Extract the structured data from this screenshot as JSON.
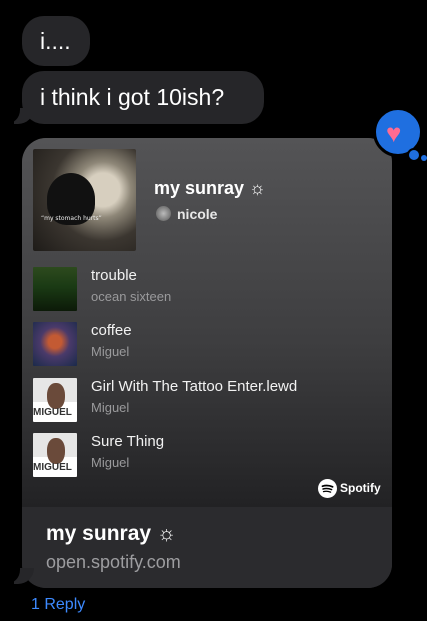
{
  "messages": [
    {
      "text": "i...."
    },
    {
      "text": "i think i got 10ish?"
    }
  ],
  "link_card": {
    "playlist_title": "my sunray ☼",
    "owner": "nicole",
    "cover_caption": "“my stomach hurts”",
    "tracks": [
      {
        "title": "trouble",
        "artist": "ocean sixteen",
        "art": "trouble"
      },
      {
        "title": "coffee",
        "artist": "Miguel",
        "art": "coffee"
      },
      {
        "title": "Girl With The Tattoo Enter.lewd",
        "artist": "Miguel",
        "art": "miguel",
        "art_text": "MIGUEL"
      },
      {
        "title": "Sure Thing",
        "artist": "Miguel",
        "art": "miguel",
        "art_text": "MIGUEL"
      }
    ],
    "brand": "Spotify",
    "footer_title": "my sunray ☼",
    "footer_url": "open.spotify.com"
  },
  "reaction": {
    "icon": "heart-icon",
    "glyph": "♥",
    "color": "#ff6b92",
    "badge_color": "#1f6fe0"
  },
  "reply_link": "1 Reply"
}
